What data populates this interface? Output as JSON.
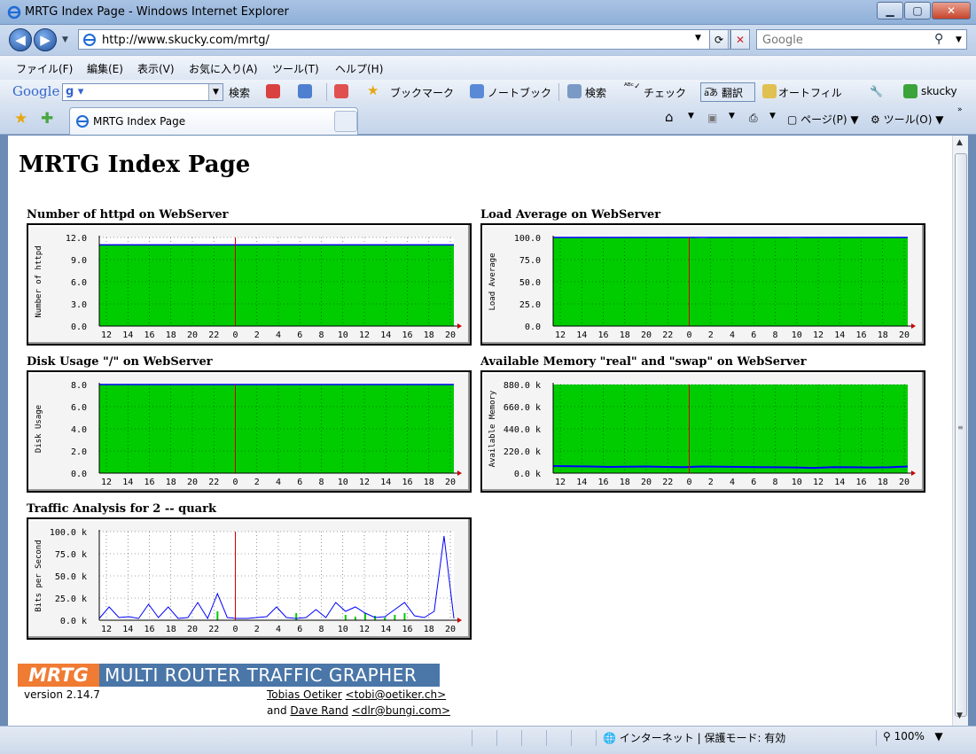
{
  "window": {
    "title": "MRTG Index Page - Windows Internet Explorer"
  },
  "nav": {
    "url": "http://www.skucky.com/mrtg/",
    "search_placeholder": "Google"
  },
  "menu": [
    "ファイル(F)",
    "編集(E)",
    "表示(V)",
    "お気に入り(A)",
    "ツール(T)",
    "ヘルプ(H)"
  ],
  "google_bar": {
    "logo": "Google",
    "search_label": "検索",
    "items": [
      "ブックマーク",
      "ノートブック",
      "検索",
      "チェック",
      "翻訳",
      "オートフィル",
      "skucky"
    ]
  },
  "tab": {
    "label": "MRTG Index Page"
  },
  "commands": {
    "page": "ページ(P)",
    "tools": "ツール(O)"
  },
  "page": {
    "heading": "MRTG Index Page",
    "graphs": [
      {
        "title": "Number of httpd on WebServer",
        "ylabel": "Number of httpd",
        "yticks": [
          "12.0",
          "9.0",
          "6.0",
          "3.0",
          "0.0"
        ],
        "xticks": [
          "12",
          "14",
          "16",
          "18",
          "20",
          "22",
          "0",
          "2",
          "4",
          "6",
          "8",
          "10",
          "12",
          "14",
          "16",
          "18",
          "20"
        ],
        "chart_data": {
          "type": "area",
          "ylim": [
            0,
            12
          ],
          "series": [
            {
              "values": [
                11,
                11,
                11,
                11,
                11,
                11,
                11,
                11,
                11,
                11,
                11,
                11,
                11,
                11,
                11,
                11,
                11,
                11,
                11,
                11
              ]
            }
          ]
        }
      },
      {
        "title": "Load Average on WebServer",
        "ylabel": "Load Average",
        "yticks": [
          "100.0",
          "75.0",
          "50.0",
          "25.0",
          "0.0"
        ],
        "xticks": [
          "12",
          "14",
          "16",
          "18",
          "20",
          "22",
          "0",
          "2",
          "4",
          "6",
          "8",
          "10",
          "12",
          "14",
          "16",
          "18",
          "20"
        ],
        "chart_data": {
          "type": "area",
          "ylim": [
            0,
            100
          ],
          "series": [
            {
              "values": [
                100,
                100,
                100,
                100,
                100,
                100,
                100,
                100,
                99,
                100,
                100,
                100,
                100,
                99,
                100,
                100,
                100,
                100,
                100,
                100
              ]
            }
          ]
        }
      },
      {
        "title": "Disk Usage \"/\" on WebServer",
        "ylabel": "Disk Usage",
        "yticks": [
          "8.0",
          "6.0",
          "4.0",
          "2.0",
          "0.0"
        ],
        "xticks": [
          "12",
          "14",
          "16",
          "18",
          "20",
          "22",
          "0",
          "2",
          "4",
          "6",
          "8",
          "10",
          "12",
          "14",
          "16",
          "18",
          "20"
        ],
        "chart_data": {
          "type": "area",
          "ylim": [
            0,
            8
          ],
          "series": [
            {
              "values": [
                8,
                8,
                8,
                8,
                8,
                8,
                8,
                8,
                8,
                8,
                8,
                8,
                8,
                8,
                8,
                8,
                8,
                8,
                8,
                8
              ]
            }
          ]
        }
      },
      {
        "title": "Available Memory \"real\" and \"swap\" on WebServer",
        "ylabel": "Available Memory",
        "yticks": [
          "880.0 k",
          "660.0 k",
          "440.0 k",
          "220.0 k",
          "0.0 k"
        ],
        "xticks": [
          "12",
          "14",
          "16",
          "18",
          "20",
          "22",
          "0",
          "2",
          "4",
          "6",
          "8",
          "10",
          "12",
          "14",
          "16",
          "18",
          "20"
        ],
        "chart_data": {
          "type": "area",
          "ylim": [
            0,
            880000
          ],
          "series": [
            {
              "values": [
                880000,
                880000,
                880000,
                880000,
                880000,
                880000,
                880000,
                880000,
                880000,
                880000,
                880000,
                880000,
                880000,
                880000,
                880000,
                880000,
                880000,
                880000,
                880000,
                880000
              ]
            },
            {
              "values": [
                70000,
                68000,
                66000,
                62000,
                64000,
                66000,
                62000,
                60000,
                66000,
                64000,
                62000,
                60000,
                58000,
                56000,
                52000,
                60000,
                58000,
                56000,
                58000,
                66000
              ]
            }
          ]
        }
      },
      {
        "title": "Traffic Analysis for 2 -- quark",
        "ylabel": "Bits per Second",
        "yticks": [
          "100.0 k",
          "75.0 k",
          "50.0 k",
          "25.0 k",
          "0.0 k"
        ],
        "xticks": [
          "12",
          "14",
          "16",
          "18",
          "20",
          "22",
          "0",
          "2",
          "4",
          "6",
          "8",
          "10",
          "12",
          "14",
          "16",
          "18",
          "20"
        ],
        "chart_data": {
          "type": "line",
          "ylim": [
            0,
            100000
          ],
          "series": [
            {
              "values": [
                2000,
                15000,
                3000,
                4000,
                2000,
                18000,
                3000,
                15000,
                2000,
                3000,
                20000,
                2000,
                30000,
                3000,
                2000,
                2000,
                3000,
                4000,
                15000,
                3000,
                2000,
                3000,
                12000,
                3000,
                20000,
                10000,
                15000,
                8000,
                3000,
                4000,
                12000,
                20000,
                5000,
                3000,
                10000,
                95000,
                2000
              ]
            },
            {
              "values": [
                0,
                0,
                0,
                0,
                0,
                0,
                0,
                0,
                0,
                0,
                0,
                0,
                10000,
                0,
                0,
                0,
                0,
                0,
                0,
                0,
                8000,
                0,
                0,
                0,
                0,
                6000,
                4000,
                8000,
                5000,
                3000,
                6000,
                8000,
                0,
                0,
                0,
                0,
                0
              ]
            }
          ]
        }
      }
    ],
    "footer": {
      "logo_mrtg": "MRTG",
      "logo_text": "MULTI ROUTER TRAFFIC GRAPHER",
      "version": "version 2.14.7",
      "author1": "Tobias Oetiker",
      "email1": "<tobi@oetiker.ch>",
      "and": "and",
      "author2": "Dave Rand",
      "email2": "<dlr@bungi.com>"
    }
  },
  "status": {
    "zone": "インターネット | 保護モード: 有効",
    "zoom": "100%"
  },
  "colors": {
    "area": "#00cc00",
    "line": "#0000ff",
    "nowline": "#cc0000"
  }
}
